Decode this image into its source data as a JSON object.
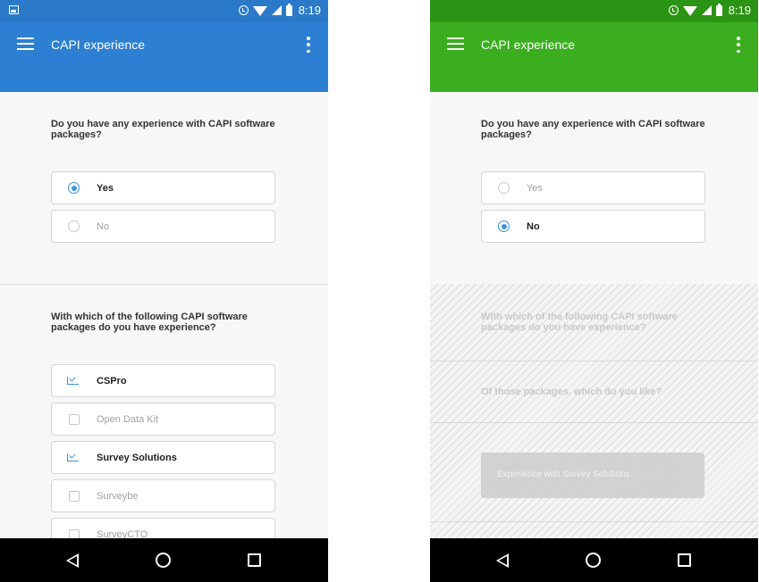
{
  "colors": {
    "left_header": "#2d7fd3",
    "left_status": "#2b7ac9",
    "right_header": "#3aae1e",
    "right_status": "#2c9414",
    "accent": "#3a94d8"
  },
  "left": {
    "status": {
      "time": "8:19"
    },
    "app_bar": {
      "title": "CAPI experience"
    },
    "q1": {
      "text": "Do you have any experience with CAPI software packages?",
      "options": [
        {
          "label": "Yes",
          "selected": true
        },
        {
          "label": "No",
          "selected": false
        }
      ]
    },
    "q2": {
      "text": "With which of the following CAPI software packages do you have experience?",
      "options": [
        {
          "label": "CSPro",
          "checked": true
        },
        {
          "label": "Open Data Kit",
          "checked": false
        },
        {
          "label": "Survey Solutions",
          "checked": true
        },
        {
          "label": "Surveybe",
          "checked": false
        },
        {
          "label": "SurveyCTO",
          "checked": false
        }
      ]
    }
  },
  "right": {
    "status": {
      "time": "8:19"
    },
    "app_bar": {
      "title": "CAPI experience"
    },
    "q1": {
      "text": "Do you have any experience with CAPI software packages?",
      "options": [
        {
          "label": "Yes",
          "selected": false
        },
        {
          "label": "No",
          "selected": true
        }
      ]
    },
    "disabled": {
      "q2_text": "With which of the following CAPI software packages do you have experience?",
      "q3_text": "Of those packages, which do you like?",
      "button_label": "Experience with Survey Solutions"
    }
  },
  "nav": {
    "icons": [
      "back-icon",
      "home-icon",
      "recents-icon"
    ]
  }
}
